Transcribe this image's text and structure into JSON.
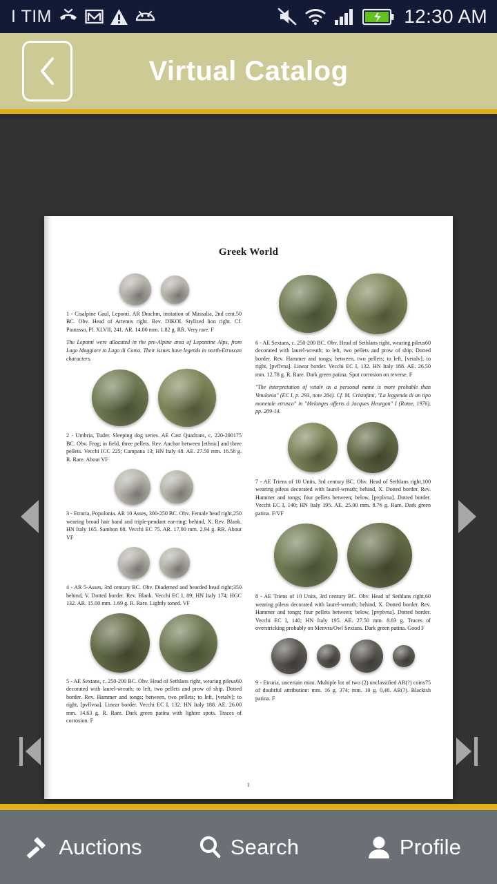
{
  "status_bar": {
    "carrier": "I TIM",
    "time": "12:30 AM",
    "left_icons": [
      "missed-call-icon",
      "gmail-icon",
      "warning-icon",
      "android-icon"
    ],
    "right_icons": [
      "volume-mute-icon",
      "wifi-icon",
      "cellular-signal-icon",
      "battery-charging-icon"
    ],
    "background_color": "#131a36"
  },
  "header": {
    "title": "Virtual Catalog",
    "back_label": "Back",
    "background_color": "#cdca95",
    "accent_color": "#e0ae16"
  },
  "viewer": {
    "background_color": "#333333",
    "controls": {
      "prev_page": "Previous page",
      "next_page": "Next page",
      "first_page": "First page",
      "last_page": "Last page"
    }
  },
  "document": {
    "heading": "Greek World",
    "folio": "1",
    "left_column": [
      {
        "coins": [
          {
            "type": "ag",
            "size": 46
          },
          {
            "type": "ag",
            "size": 41
          }
        ],
        "text": "1 -  Cisalpine Gaul, Lepontí.  AR Drachm, imitation of Massalia, 2nd cent. BC.  Obv. Head of Artemis right. Rev. DIKOI. Stylized lion right. Cf. Pautasso, Pl. XLVII, 241.  AR.       14.00 mm. 1.82 g.  RR. Very rare.  F",
        "price": "50",
        "note": "The Lepontí were allocated in the pre-Alpine area of Lepontine Alps, from Lago Maggiore to Lago di Como. Their issues have legends in north-Etruscan characters."
      },
      {
        "coins": [
          {
            "type": "ae",
            "size": 82
          },
          {
            "type": "ae2",
            "size": 84
          }
        ],
        "text": "2 -  Umbria, Tuder. Sleeping dog series.  AE Cast Quadrans, c. 220-200 BC.    Obv. Frog; in field, three pellets. Rev. Anchor between [ethnic] and three pellets. Vecchi ICC 225; Campana 13; HN Italy 48. AE.     27.50 mm. 16.58 g. R. Rare.  About VF",
        "price": "175",
        "note": ""
      },
      {
        "coins": [
          {
            "type": "ag",
            "size": 52
          },
          {
            "type": "ag",
            "size": 48
          }
        ],
        "text": "3 - Etruria, Populonia.  AR 10 Asses, 300-250 BC.   Obv. Female head right, wearing broad hair band and triple-pendant ear-ring; behind, X. Rev. Blank. HN Italy 165. Sambon 68. Vecchi EC 75. AR.      17.00 mm. 2.94 g. RR.  About VF",
        "price": "250",
        "note": ""
      },
      {
        "coins": [
          {
            "type": "ag",
            "size": 46
          },
          {
            "type": "ag",
            "size": 44
          }
        ],
        "text": "4 -   AR 5-Asses, 3rd century BC.    Obv. Diademed and bearded head right; behind, V. Dotted border. Rev. Blank. Vecchi EC I, 89; HN Italy 174; HGC 132. AR.      15.00 mm. 1.69 g. R. Rare. Lightly toned.  VF",
        "price": "350",
        "note": ""
      },
      {
        "coins": [
          {
            "type": "ae3",
            "size": 86
          },
          {
            "type": "ae",
            "size": 84
          }
        ],
        "text": "5 -   AE Sextans, c. 250-200 BC.    Obv. Head of Sethlans right, wearing pileus decorated with laurel-wreath; to left, two pellets and prow of ship. Dotted border. Rev. Hammer and tongs; between, two pellets; to left, [vetalv]; to right, [pvflvna]. Linear border. Vecchi EC I, 132. HN Italy 188.  AE.      26.00 mm. 14.63 g. R. Rare. Dark green patina with lighter spots. Traces of corrosion.  F",
        "price": "60",
        "note": ""
      }
    ],
    "right_column": [
      {
        "coins": [
          {
            "type": "ae",
            "size": 84
          },
          {
            "type": "ae2",
            "size": 88
          }
        ],
        "text": "6 -    AE Sextans, c. 250-200 BC.    Obv. Head of Sethlans right, wearing pileus decorated with laurel-wreath; to left, two pellets and prow of ship. Dotted border. Rev. Hammer and tongs; between, two pellets; to left, [vetalv]; to right, [pvflvna]. Linear border. Vecchi EC I, 132. HN Italy 188.  AE.     26.50 mm. 12.78 g. R. Rare. Dark green patina. Spot corrosion on reverse.  F",
        "price": "60",
        "note": "\"The interpretation of vetalv as a personal name is more probable than Vetulonia\" (EC I, p. 293, note 284). Cf. M. Cristofani, \"La leggenda di un tipo monetale etrusco\" in \"Melanges offerts à Jacques Heurgon\" I (Rome, 1976), pp. 209-14."
      },
      {
        "coins": [
          {
            "type": "ae2",
            "size": 72
          },
          {
            "type": "ae3",
            "size": 74
          }
        ],
        "text": "7 -   AE Triens of 10 Units, 3rd century BC.   Obv. Head of Sethlans right, wearing pileus decorated with laurel-wreath; behind, X. Dotted border. Rev. Hammer and tongs; four pellets between; below, [pvplvna]. Dotted border. Vecchi EC I, 140; HN Italy 195.  AE. 25.00 mm. 8.76 g.  Rare. Dark green patina.  F/VF",
        "price": "100",
        "note": ""
      },
      {
        "coins": [
          {
            "type": "ae",
            "size": 92
          },
          {
            "type": "ae3",
            "size": 94
          }
        ],
        "text": "8 -   AE Triens of 10 Units, 3rd century BC.   Obv. Head of Sethlans right, wearing pileus decorated with laurel-wreath; behind, X. Dotted border. Rev. Hammer and tongs; four pellets between; below, [pvplvna]. Dotted border. Vecchi EC I, 140; HN Italy 195.  AE. 27.50 mm. 8.83 g.  Traces of overstricking probably on Menvra/Owl Sextans. Dark green patina.  Good F",
        "price": "60",
        "note": ""
      },
      {
        "coins": [
          {
            "type": "blk",
            "size": 52
          },
          {
            "type": "blk",
            "size": 34
          },
          {
            "type": "blk",
            "size": 48
          },
          {
            "type": "blk",
            "size": 32
          }
        ],
        "text": "9 -  Etruria, uncertain mint.  Multiple lot of two (2) unclassified AR(?) coins of doubtful attribution: mm. 16 g. 374; mm. 10 g. 0,48. AR(?).      Blackish patina.  F",
        "price": "75",
        "note": ""
      }
    ]
  },
  "bottom_bar": {
    "background_color": "#6b7076",
    "accent_color": "#e0ae16",
    "tabs": [
      {
        "icon": "gavel-icon",
        "label": "Auctions"
      },
      {
        "icon": "search-icon",
        "label": "Search"
      },
      {
        "icon": "person-icon",
        "label": "Profile"
      }
    ]
  }
}
